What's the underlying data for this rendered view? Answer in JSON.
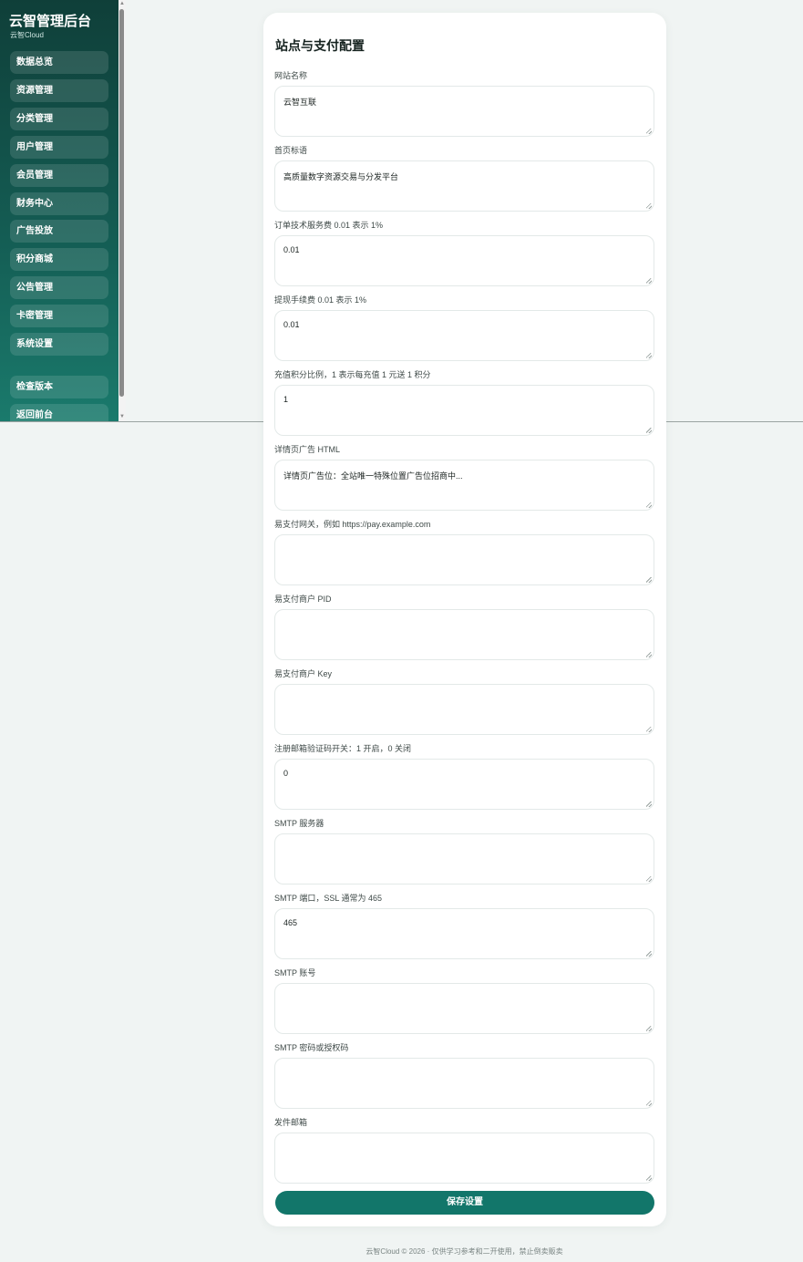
{
  "sidebar": {
    "title": "云智管理后台",
    "subtitle": "云智Cloud",
    "items": [
      {
        "label": "数据总览"
      },
      {
        "label": "资源管理"
      },
      {
        "label": "分类管理"
      },
      {
        "label": "用户管理"
      },
      {
        "label": "会员管理"
      },
      {
        "label": "财务中心"
      },
      {
        "label": "广告投放"
      },
      {
        "label": "积分商城"
      },
      {
        "label": "公告管理"
      },
      {
        "label": "卡密管理"
      },
      {
        "label": "系统设置"
      }
    ],
    "check_version": "检查版本",
    "back_to_front": "返回前台"
  },
  "main": {
    "title": "站点与支付配置",
    "fields": [
      {
        "label": "网站名称",
        "value": "云智互联"
      },
      {
        "label": "首页标语",
        "value": "高质量数字资源交易与分发平台"
      },
      {
        "label": "订单技术服务费 0.01 表示 1%",
        "value": "0.01"
      },
      {
        "label": "提现手续费 0.01 表示 1%",
        "value": "0.01"
      },
      {
        "label": "充值积分比例，1 表示每充值 1 元送 1 积分",
        "value": "1"
      },
      {
        "label": "详情页广告 HTML",
        "value": "详情页广告位：全站唯一特殊位置广告位招商中..."
      },
      {
        "label": "易支付网关，例如 https://pay.example.com",
        "value": ""
      },
      {
        "label": "易支付商户 PID",
        "value": ""
      },
      {
        "label": "易支付商户 Key",
        "value": ""
      },
      {
        "label": "注册邮箱验证码开关：1 开启，0 关闭",
        "value": "0"
      },
      {
        "label": "SMTP 服务器",
        "value": ""
      },
      {
        "label": "SMTP 端口，SSL 通常为 465",
        "value": "465"
      },
      {
        "label": "SMTP 账号",
        "value": ""
      },
      {
        "label": "SMTP 密码或授权码",
        "value": ""
      },
      {
        "label": "发件邮箱",
        "value": ""
      }
    ],
    "save_label": "保存设置"
  },
  "footer": "云智Cloud © 2026 · 仅供学习参考和二开使用，禁止倒卖贩卖",
  "colors": {
    "accent": "#12766a",
    "sidebar_dark": "#0f3f39",
    "page_bg": "#f0f4f3"
  }
}
